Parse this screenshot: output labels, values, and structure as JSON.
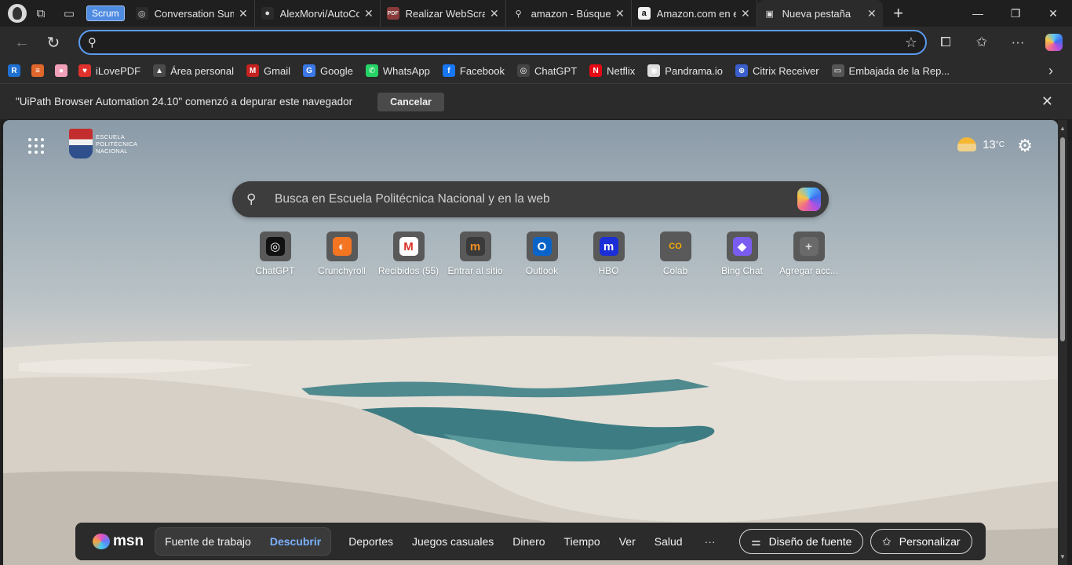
{
  "tabs": [
    {
      "label": "Conversation Sum",
      "fav": "◎",
      "fav_bg": "#2b2b2b"
    },
    {
      "label": "AlexMorvi/AutoCo",
      "fav": "●",
      "fav_bg": "#2b2b2b"
    },
    {
      "label": "Realizar WebScrap",
      "fav": "PDF",
      "fav_bg": "#8a3a3a"
    },
    {
      "label": "amazon - Búsqued",
      "fav": "⚲",
      "fav_bg": "#1f1f1f"
    },
    {
      "label": "Amazon.com en es",
      "fav": "a",
      "fav_bg": "#f0f0f0"
    },
    {
      "label": "Nueva pestaña",
      "fav": "▣",
      "fav_bg": "#2b2b2b"
    }
  ],
  "tab_group": "Scrum",
  "address": {
    "value": "",
    "placeholder": ""
  },
  "bookmarks": [
    {
      "label": "",
      "icon": "R",
      "color": "#1f6fd1"
    },
    {
      "label": "",
      "icon": "≡",
      "color": "#e0672b"
    },
    {
      "label": "",
      "icon": "●",
      "color": "#f0a0b8"
    },
    {
      "label": "iLovePDF",
      "icon": "♥",
      "color": "#e0322c"
    },
    {
      "label": "Área personal",
      "icon": "▲",
      "color": "#4a4a4a"
    },
    {
      "label": "Gmail",
      "icon": "M",
      "color": "#c5221f"
    },
    {
      "label": "Google",
      "icon": "G",
      "color": "#3b78e7"
    },
    {
      "label": "WhatsApp",
      "icon": "✆",
      "color": "#25d366"
    },
    {
      "label": "Facebook",
      "icon": "f",
      "color": "#1877f2"
    },
    {
      "label": "ChatGPT",
      "icon": "◎",
      "color": "#444"
    },
    {
      "label": "Netflix",
      "icon": "N",
      "color": "#e50914"
    },
    {
      "label": "Pandrama.io",
      "icon": "◉",
      "color": "#ddd"
    },
    {
      "label": "Citrix Receiver",
      "icon": "⊕",
      "color": "#3a5fcd"
    },
    {
      "label": "Embajada de la Rep...",
      "icon": "▭",
      "color": "#555"
    }
  ],
  "infobar": {
    "message": "\"UiPath Browser Automation 24.10\" comenzó a depurar este navegador",
    "cancel": "Cancelar"
  },
  "logo_lines": [
    "ESCUELA",
    "POLITÉCNICA",
    "NACIONAL"
  ],
  "weather": {
    "temp": "13",
    "unit": "°C"
  },
  "search": {
    "placeholder": "Busca en Escuela Politécnica Nacional y en la web"
  },
  "tiles": [
    {
      "label": "ChatGPT",
      "bg": "#111",
      "glyph": "◎",
      "color": "#fff"
    },
    {
      "label": "Crunchyroll",
      "bg": "#f47521",
      "glyph": "◐",
      "color": "#fff"
    },
    {
      "label": "Recibidos (55)",
      "bg": "#ffffff",
      "glyph": "M",
      "color": "#d93025"
    },
    {
      "label": "Entrar al sitio",
      "bg": "#3a3a3a",
      "glyph": "m",
      "color": "#f29024"
    },
    {
      "label": "Outlook",
      "bg": "#0a64c8",
      "glyph": "O",
      "color": "#fff"
    },
    {
      "label": "HBO",
      "bg": "#1c2fd6",
      "glyph": "m",
      "color": "#fff"
    },
    {
      "label": "Colab",
      "bg": "#595959",
      "glyph": "CO",
      "color": "#f9ab00"
    },
    {
      "label": "Bing Chat",
      "bg": "#7a5cf0",
      "glyph": "◆",
      "color": "#fff"
    },
    {
      "label": "Agregar acc...",
      "bg": "#6a6a6a",
      "glyph": "+",
      "color": "#ddd"
    }
  ],
  "msn": {
    "logo": "msn",
    "pill": [
      "Fuente de trabajo",
      "Descubrir"
    ],
    "links": [
      "Deportes",
      "Juegos casuales",
      "Dinero",
      "Tiempo",
      "Ver",
      "Salud"
    ],
    "more": "···",
    "feed_design": "Diseño de fuente",
    "personalize": "Personalizar"
  }
}
